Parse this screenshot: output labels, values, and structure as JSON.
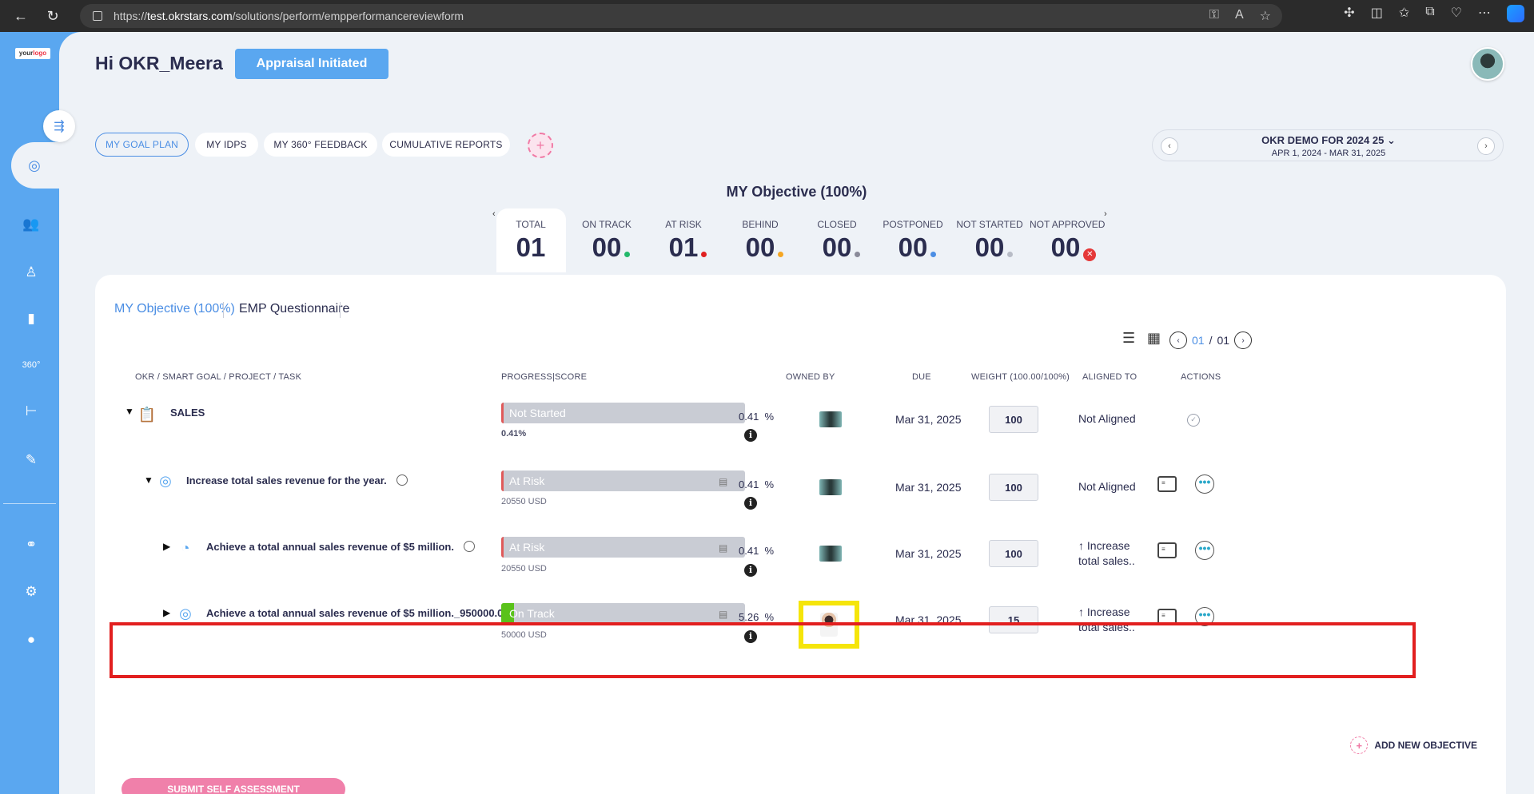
{
  "browser": {
    "url_prefix": "https://",
    "url_host": "test.okrstars.com",
    "url_path": "/solutions/perform/empperformancereviewform"
  },
  "header": {
    "greeting": "Hi OKR_Meera",
    "appraisal_label": "Appraisal Initiated"
  },
  "logo": {
    "text_a": "your",
    "text_b": "logo"
  },
  "top_tabs": [
    {
      "label": "MY GOAL PLAN",
      "active": true
    },
    {
      "label": "MY IDPS",
      "active": false
    },
    {
      "label": "MY 360° FEEDBACK",
      "active": false
    },
    {
      "label": "CUMULATIVE REPORTS",
      "active": false
    }
  ],
  "period": {
    "title": "OKR DEMO FOR 2024 25",
    "range": "APR 1, 2024 - MAR 31, 2025"
  },
  "objective_title": "MY Objective (100%)",
  "stats": [
    {
      "label": "TOTAL",
      "value": "01",
      "dot": ""
    },
    {
      "label": "ON TRACK",
      "value": "00",
      "dot": "#22b86a"
    },
    {
      "label": "AT RISK",
      "value": "01",
      "dot": "#e02020"
    },
    {
      "label": "BEHIND",
      "value": "00",
      "dot": "#f5a623"
    },
    {
      "label": "CLOSED",
      "value": "00",
      "dot": "#8a8a99"
    },
    {
      "label": "POSTPONED",
      "value": "00",
      "dot": "#4b8ee4"
    },
    {
      "label": "NOT STARTED",
      "value": "00",
      "dot": "#b8bcc6"
    },
    {
      "label": "NOT APPROVED",
      "value": "00",
      "dot": ""
    }
  ],
  "sub_tabs": {
    "objective": "MY Objective (100%)",
    "questionnaire": "EMP Questionnaire"
  },
  "pager": {
    "current": "01",
    "sep": "/",
    "total": "01"
  },
  "columns": {
    "name": "OKR / SMART GOAL / PROJECT / TASK",
    "progress": "PROGRESS|SCORE",
    "owned": "OWNED BY",
    "due": "DUE",
    "weight": "WEIGHT (100.00/100%)",
    "aligned": "ALIGNED TO",
    "actions": "ACTIONS"
  },
  "rows": [
    {
      "name": "SALES",
      "status": "Not Started",
      "progress": 0.41,
      "progress_sub": "0.41%",
      "score": "0.41",
      "pct_sign": "%",
      "due": "Mar 31, 2025",
      "weight": "100",
      "aligned": "Not Aligned",
      "status_color": "#e05a5a"
    },
    {
      "name": "Increase total sales revenue for the year.",
      "status": "At Risk",
      "progress": 0.41,
      "progress_sub": "20550 USD",
      "score": "0.41",
      "pct_sign": "%",
      "due": "Mar 31, 2025",
      "weight": "100",
      "aligned": "Not Aligned",
      "status_color": "#e05a5a"
    },
    {
      "name": "Achieve a total annual sales revenue of $5 million.",
      "status": "At Risk",
      "progress": 0.41,
      "progress_sub": "20550 USD",
      "score": "0.41",
      "pct_sign": "%",
      "due": "Mar 31, 2025",
      "weight": "100",
      "aligned_line1": "↑ Increase",
      "aligned_line2": "total sales..",
      "status_color": "#e05a5a"
    },
    {
      "name": "Achieve a total annual sales revenue of $5 million._950000.0 USD",
      "status": "On Track",
      "progress": 5.26,
      "progress_sub": "50000 USD",
      "score": "5.26",
      "pct_sign": "%",
      "due": "Mar 31, 2025",
      "weight": "15",
      "aligned_line1": "↑ Increase",
      "aligned_line2": "total sales..",
      "status_color": "#5ac21a"
    }
  ],
  "add_objective_label": "ADD NEW OBJECTIVE",
  "submit_label": "SUBMIT SELF ASSESSMENT"
}
